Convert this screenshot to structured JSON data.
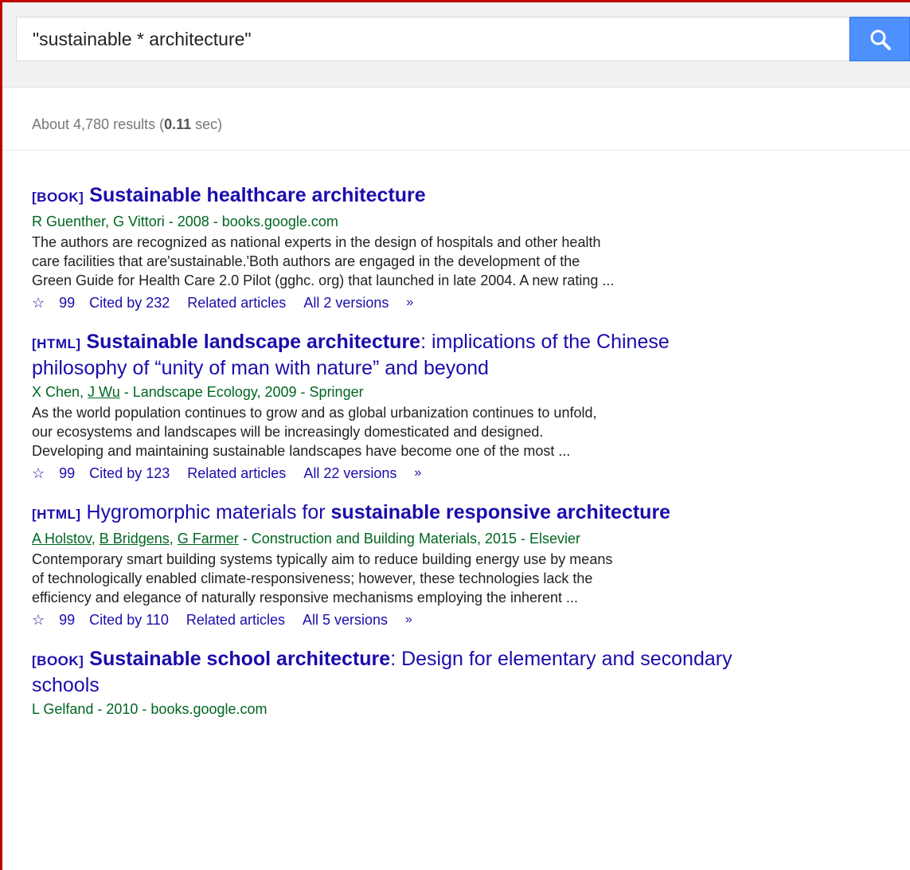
{
  "search": {
    "query": "\"sustainable * architecture\""
  },
  "stats": {
    "prefix": "About 4,780 results (",
    "time": "0.11",
    "suffix": " sec)"
  },
  "results": [
    {
      "type": "[BOOK]",
      "title_bold": "Sustainable healthcare architecture",
      "title_rest": "",
      "title_line2": "",
      "meta_authors": "R Guenther, G Vittori",
      "meta_rest": " - 2008 - books.google.com",
      "snippet": [
        "The authors are recognized as national experts in the design of hospitals and other health",
        "care facilities that are'sustainable.'Both authors are engaged in the development of the",
        "Green Guide for Health Care 2.0 Pilot (gghc. org) that launched in late 2004. A new rating ..."
      ],
      "cited": "Cited by 232",
      "related": "Related articles",
      "versions": "All 2 versions"
    },
    {
      "type": "[HTML]",
      "title_bold": "Sustainable landscape architecture",
      "title_rest": ": implications of the Chinese",
      "title_line2": "philosophy of “unity of man with nature” and beyond",
      "meta_authors_plain": "X Chen, ",
      "meta_author_link": "J Wu",
      "meta_rest": " - Landscape Ecology, 2009 - Springer",
      "snippet": [
        "As the world population continues to grow and as global urbanization continues to unfold,",
        "our ecosystems and landscapes will be increasingly domesticated and designed.",
        "Developing and maintaining sustainable landscapes have become one of the most ..."
      ],
      "cited": "Cited by 123",
      "related": "Related articles",
      "versions": "All 22 versions"
    },
    {
      "type": "[HTML]",
      "title_plain": "Hygromorphic materials for ",
      "title_bold": "sustainable responsive architecture",
      "meta_author_link1": "A Holstov",
      "meta_author_link2": "B Bridgens",
      "meta_author_link3": "G Farmer",
      "meta_sep": ", ",
      "meta_rest": " - Construction and Building Materials, 2015 - Elsevier",
      "snippet": [
        "Contemporary smart building systems typically aim to reduce building energy use by means",
        "of technologically enabled climate-responsiveness; however, these technologies lack the",
        "efficiency and elegance of naturally responsive mechanisms employing the inherent ..."
      ],
      "cited": "Cited by 110",
      "related": "Related articles",
      "versions": "All 5 versions"
    },
    {
      "type": "[BOOK]",
      "title_bold": "Sustainable school architecture",
      "title_rest": ": Design for elementary and secondary",
      "title_line2": "schools",
      "meta_authors": "L Gelfand",
      "meta_rest": " - 2010 - books.google.com"
    }
  ],
  "colors": {
    "link": "#1a0dab",
    "meta": "#006621",
    "search_button": "#4d90fe",
    "frame": "#c00000"
  },
  "icons": {
    "search": "magnifier-icon",
    "save": "star-icon",
    "cite": "quote-icon",
    "more": "double-chevron-icon"
  }
}
